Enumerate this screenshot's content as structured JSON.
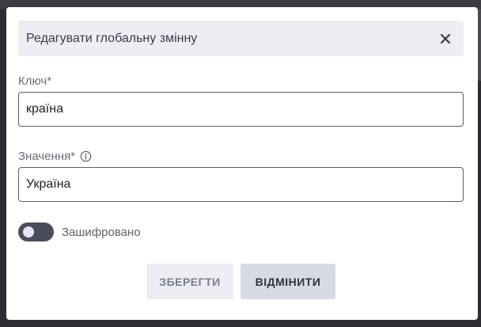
{
  "dialog": {
    "title": "Редагувати глобальну змінну",
    "close_icon": "close-icon"
  },
  "form": {
    "key_label": "Ключ*",
    "key_value": "країна",
    "value_label": "Значення*",
    "value_value": "Україна",
    "info_icon": "info-icon",
    "encrypted_label": "Зашифровано",
    "encrypted_on": false
  },
  "actions": {
    "save_label": "ЗБЕРЕГТИ",
    "cancel_label": "ВІДМІНИТИ"
  },
  "colors": {
    "overlay": "#2b2d31",
    "header_bg": "#eceef3",
    "toggle_off": "#4a4d5c",
    "cancel_bg": "#d8dbe4"
  }
}
